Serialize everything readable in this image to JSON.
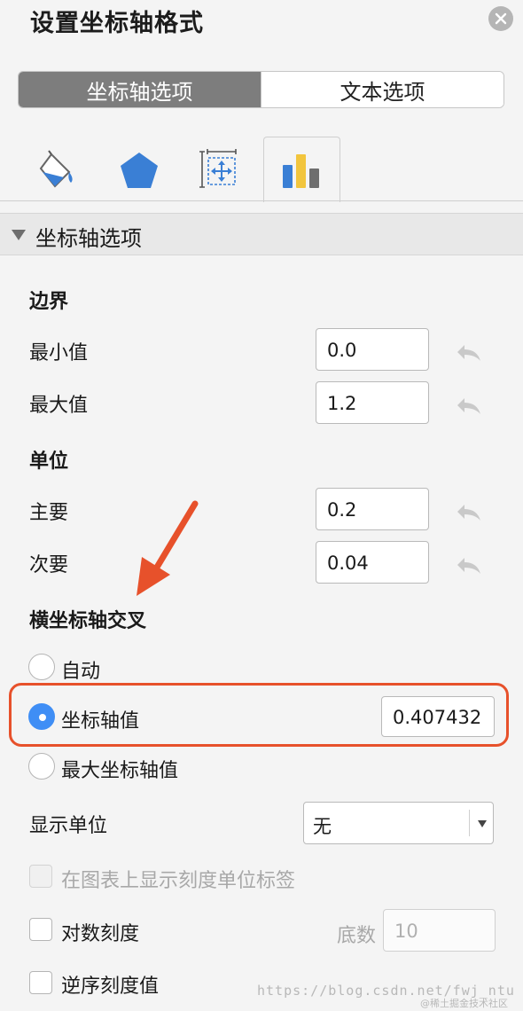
{
  "header": {
    "title": "设置坐标轴格式"
  },
  "segmented": {
    "axis_options": "坐标轴选项",
    "text_options": "文本选项"
  },
  "icon_tabs": [
    "fill-line-icon",
    "effects-pentagon-icon",
    "size-properties-icon",
    "axis-options-bar-chart-icon"
  ],
  "section": {
    "title": "坐标轴选项"
  },
  "bounds": {
    "label": "边界",
    "min_label": "最小值",
    "min_value": "0.0",
    "max_label": "最大值",
    "max_value": "1.2"
  },
  "units": {
    "label": "单位",
    "major_label": "主要",
    "major_value": "0.2",
    "minor_label": "次要",
    "minor_value": "0.04"
  },
  "cross": {
    "label": "横坐标轴交叉",
    "auto_label": "自动",
    "axis_value_label": "坐标轴值",
    "axis_value": "0.407432",
    "max_axis_label": "最大坐标轴值"
  },
  "display_units": {
    "label": "显示单位",
    "value": "无"
  },
  "show_units_label": {
    "label": "在图表上显示刻度单位标签"
  },
  "log_scale": {
    "label": "对数刻度",
    "base_label": "底数",
    "base_value": "10"
  },
  "reverse": {
    "label": "逆序刻度值"
  },
  "watermark": {
    "url": "https://blog.csdn.net/fwj_ntu",
    "community": "@稀土掘金技术社区"
  },
  "colors": {
    "accent": "#3f8ef5",
    "highlight": "#e7512b",
    "active_segment": "#7d7d7d"
  }
}
